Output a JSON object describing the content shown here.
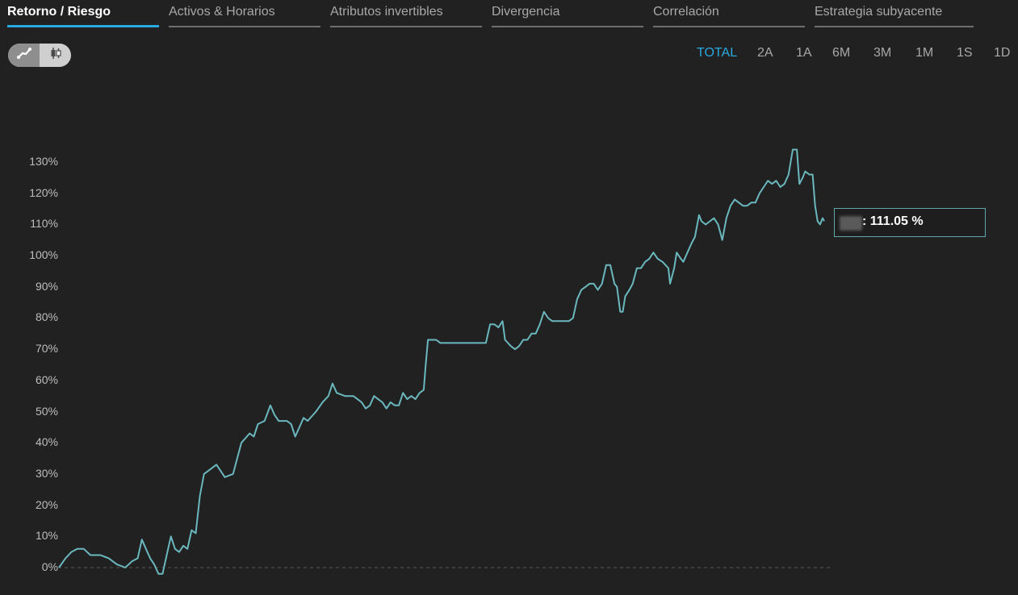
{
  "tabs": [
    {
      "label": "Retorno / Riesgo",
      "active": true
    },
    {
      "label": "Activos & Horarios",
      "active": false
    },
    {
      "label": "Atributos invertibles",
      "active": false
    },
    {
      "label": "Divergencia",
      "active": false
    },
    {
      "label": "Correlación",
      "active": false
    },
    {
      "label": "Estrategia subyacente",
      "active": false
    }
  ],
  "chart_mode": {
    "selected": "line",
    "options": [
      "line-chart-icon",
      "candlestick-icon"
    ]
  },
  "ranges": [
    {
      "label": "TOTAL",
      "active": true
    },
    {
      "label": "2A",
      "active": false
    },
    {
      "label": "1A",
      "active": false
    },
    {
      "label": "6M",
      "active": false
    },
    {
      "label": "3M",
      "active": false
    },
    {
      "label": "1M",
      "active": false
    },
    {
      "label": "1S",
      "active": false
    },
    {
      "label": "1D",
      "active": false
    }
  ],
  "tooltip": {
    "value": ": 111.05 %"
  },
  "colors": {
    "line": "#6ab8be",
    "accent": "#29a9e0",
    "background": "#212121"
  },
  "chart_data": {
    "type": "line",
    "title": "",
    "xlabel": "",
    "ylabel": "",
    "ylim": [
      -3,
      135
    ],
    "y_ticks": [
      "0%",
      "10%",
      "20%",
      "30%",
      "40%",
      "50%",
      "60%",
      "70%",
      "80%",
      "90%",
      "100%",
      "110%",
      "120%",
      "130%"
    ],
    "zero_baseline": "dashed",
    "x_index_range": [
      0,
      1000
    ],
    "series": [
      {
        "points": [
          [
            0,
            0
          ],
          [
            8,
            3
          ],
          [
            15,
            5
          ],
          [
            22,
            6
          ],
          [
            30,
            6
          ],
          [
            38,
            4
          ],
          [
            50,
            4
          ],
          [
            60,
            3
          ],
          [
            70,
            1
          ],
          [
            80,
            0
          ],
          [
            88,
            2
          ],
          [
            95,
            3
          ],
          [
            100,
            9
          ],
          [
            105,
            6
          ],
          [
            110,
            3
          ],
          [
            115,
            1
          ],
          [
            120,
            -2
          ],
          [
            125,
            -2
          ],
          [
            130,
            4
          ],
          [
            135,
            10
          ],
          [
            140,
            6
          ],
          [
            145,
            5
          ],
          [
            150,
            7
          ],
          [
            155,
            6
          ],
          [
            160,
            12
          ],
          [
            165,
            11
          ],
          [
            170,
            23
          ],
          [
            175,
            30
          ],
          [
            180,
            31
          ],
          [
            190,
            33
          ],
          [
            195,
            31
          ],
          [
            200,
            29
          ],
          [
            210,
            30
          ],
          [
            215,
            35
          ],
          [
            220,
            40
          ],
          [
            230,
            43
          ],
          [
            235,
            42
          ],
          [
            240,
            46
          ],
          [
            248,
            47
          ],
          [
            255,
            52
          ],
          [
            260,
            49
          ],
          [
            265,
            47
          ],
          [
            275,
            47
          ],
          [
            280,
            46
          ],
          [
            285,
            42
          ],
          [
            290,
            45
          ],
          [
            295,
            48
          ],
          [
            300,
            47
          ],
          [
            310,
            50
          ],
          [
            318,
            53
          ],
          [
            325,
            55
          ],
          [
            330,
            59
          ],
          [
            335,
            56
          ],
          [
            345,
            55
          ],
          [
            355,
            55
          ],
          [
            360,
            54
          ],
          [
            365,
            53
          ],
          [
            370,
            51
          ],
          [
            375,
            52
          ],
          [
            380,
            55
          ],
          [
            385,
            54
          ],
          [
            390,
            53
          ],
          [
            395,
            51
          ],
          [
            400,
            53
          ],
          [
            405,
            52
          ],
          [
            410,
            52
          ],
          [
            415,
            56
          ],
          [
            420,
            54
          ],
          [
            425,
            55
          ],
          [
            430,
            54
          ],
          [
            435,
            56
          ],
          [
            440,
            57
          ],
          [
            442,
            64
          ],
          [
            445,
            73
          ],
          [
            455,
            73
          ],
          [
            460,
            72
          ],
          [
            465,
            72
          ],
          [
            475,
            72
          ],
          [
            485,
            72
          ],
          [
            495,
            72
          ],
          [
            505,
            72
          ],
          [
            515,
            72
          ],
          [
            520,
            78
          ],
          [
            525,
            78
          ],
          [
            530,
            77
          ],
          [
            535,
            79
          ],
          [
            538,
            73
          ],
          [
            545,
            71
          ],
          [
            550,
            70
          ],
          [
            555,
            71
          ],
          [
            560,
            73
          ],
          [
            565,
            73
          ],
          [
            570,
            75
          ],
          [
            575,
            75
          ],
          [
            580,
            78
          ],
          [
            585,
            82
          ],
          [
            590,
            80
          ],
          [
            595,
            79
          ],
          [
            605,
            79
          ],
          [
            615,
            79
          ],
          [
            620,
            80
          ],
          [
            625,
            86
          ],
          [
            630,
            89
          ],
          [
            635,
            90
          ],
          [
            640,
            91
          ],
          [
            645,
            91
          ],
          [
            650,
            89
          ],
          [
            655,
            91
          ],
          [
            660,
            97
          ],
          [
            665,
            97
          ],
          [
            670,
            91
          ],
          [
            673,
            90
          ],
          [
            677,
            82
          ],
          [
            680,
            82
          ],
          [
            683,
            87
          ],
          [
            688,
            89
          ],
          [
            692,
            91
          ],
          [
            697,
            96
          ],
          [
            702,
            96
          ],
          [
            707,
            98
          ],
          [
            712,
            99
          ],
          [
            717,
            101
          ],
          [
            722,
            99
          ],
          [
            728,
            98
          ],
          [
            735,
            96
          ],
          [
            737,
            91
          ],
          [
            742,
            96
          ],
          [
            745,
            101
          ],
          [
            750,
            99
          ],
          [
            753,
            98
          ],
          [
            758,
            101
          ],
          [
            763,
            104
          ],
          [
            767,
            106
          ],
          [
            772,
            113
          ],
          [
            775,
            111
          ],
          [
            780,
            110
          ],
          [
            785,
            111
          ],
          [
            790,
            112
          ],
          [
            795,
            110
          ],
          [
            800,
            105
          ],
          [
            805,
            112
          ],
          [
            810,
            116
          ],
          [
            815,
            118
          ],
          [
            820,
            117
          ],
          [
            825,
            116
          ],
          [
            830,
            116
          ],
          [
            835,
            117
          ],
          [
            840,
            117
          ],
          [
            845,
            120
          ],
          [
            850,
            122
          ],
          [
            855,
            124
          ],
          [
            860,
            123
          ],
          [
            865,
            124
          ],
          [
            870,
            122
          ],
          [
            875,
            123
          ],
          [
            880,
            126
          ],
          [
            885,
            134
          ],
          [
            890,
            134
          ],
          [
            893,
            123
          ],
          [
            897,
            125
          ],
          [
            900,
            127
          ],
          [
            905,
            126
          ],
          [
            909,
            126
          ],
          [
            912,
            116
          ],
          [
            915,
            111
          ],
          [
            918,
            110
          ],
          [
            921,
            112
          ],
          [
            923,
            111.05
          ]
        ]
      }
    ]
  }
}
